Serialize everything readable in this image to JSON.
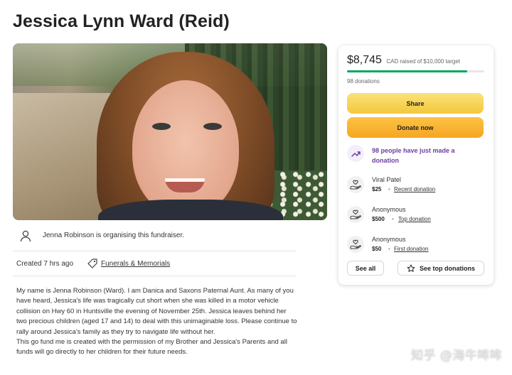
{
  "page": {
    "title": "Jessica Lynn Ward (Reid)"
  },
  "organiser": {
    "text": "Jenna Robinson is organising this fundraiser."
  },
  "meta": {
    "created": "Created 7 hrs ago",
    "category": "Funerals & Memorials"
  },
  "story": {
    "paragraphs": [
      "My name is Jenna Robinson (Ward). I am Danica and Saxons Paternal Aunt. As many of you have heard, Jessica's life was tragically cut short when she was killed in a motor vehicle collision on Hwy 60 in Huntsville the evening of November 25th. Jessica leaves behind her two precious children (aged 17 and 14) to deal with this unimaginable loss. Please continue to rally around Jessica's family as they try to navigate life without her.",
      "This go fund me is created with the permission of my Brother and Jessica's Parents and all funds will go directly to her children for their future needs."
    ]
  },
  "donation_card": {
    "amount": "$8,745",
    "raised_text": "CAD raised of $10,000 target",
    "progress_fraction": 0.8745,
    "donation_count": "98 donations",
    "share_label": "Share",
    "donate_label": "Donate now",
    "activity_text": "98 people have just made a donation",
    "donors": [
      {
        "name": "Viral Patel",
        "amount": "$25",
        "kind": "Recent donation"
      },
      {
        "name": "Anonymous",
        "amount": "$500",
        "kind": "Top donation"
      },
      {
        "name": "Anonymous",
        "amount": "$50",
        "kind": "First donation"
      }
    ],
    "see_all_label": "See all",
    "see_top_label": "See top donations"
  },
  "watermark": {
    "text": "知乎 @海牛哞哞"
  },
  "colors": {
    "progress": "#02a95c",
    "share_button": "#f3c83a",
    "donate_button": "#f5a623",
    "activity_text": "#6b3fa0"
  },
  "icons": [
    "person-icon",
    "tag-icon",
    "trend-up-icon",
    "donation-hands-icon",
    "star-icon"
  ]
}
